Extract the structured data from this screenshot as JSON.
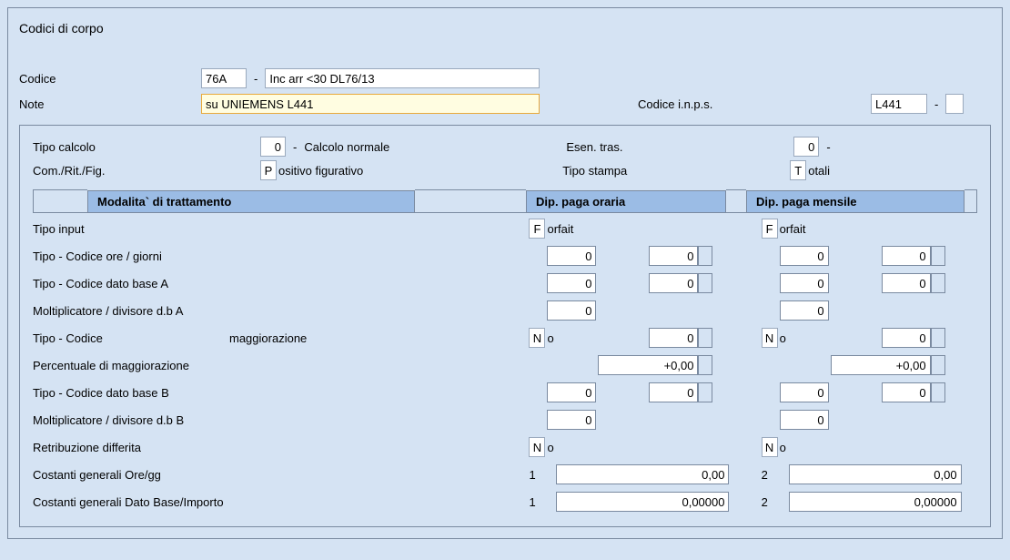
{
  "panel_title": "Codici di corpo",
  "codice": {
    "label": "Codice",
    "code": "76A",
    "desc": "Inc arr <30 DL76/13"
  },
  "note": {
    "label": "Note",
    "value": "su UNIEMENS L441"
  },
  "code_inps": {
    "label": "Codice i.n.p.s.",
    "value": "L441"
  },
  "tipo_calcolo": {
    "label": "Tipo calcolo",
    "code": "0",
    "desc": "Calcolo normale"
  },
  "esen_tras": {
    "label": "Esen. tras.",
    "code": "0"
  },
  "com_rit_fig": {
    "label": "Com./Rit./Fig.",
    "prefix": "P",
    "desc": "ositivo figurativo"
  },
  "tipo_stampa": {
    "label": "Tipo stampa",
    "prefix": "T",
    "desc": "otali"
  },
  "tabs": {
    "modo": "Modalita` di trattamento",
    "oraria": "Dip. paga oraria",
    "mensile": "Dip. paga mensile"
  },
  "rows": {
    "tipo_input": {
      "label": "Tipo input"
    },
    "tipo_cod_ore": {
      "label": "Tipo - Codice ore / giorni"
    },
    "tipo_cod_base_a": {
      "label": "Tipo - Codice dato base A"
    },
    "molt_div_a": {
      "label": "Moltiplicatore / divisore d.b A"
    },
    "tipo_cod_magg": {
      "label1": "Tipo - Codice",
      "label2": "maggiorazione"
    },
    "perc_magg": {
      "label": "Percentuale di maggiorazione"
    },
    "tipo_cod_base_b": {
      "label": "Tipo - Codice dato base B"
    },
    "molt_div_b": {
      "label": "Moltiplicatore / divisore d.b B"
    },
    "retr_diff": {
      "label": "Retribuzione differita"
    },
    "cost_ore": {
      "label": "Costanti generali Ore/gg"
    },
    "cost_dato": {
      "label": "Costanti generali Dato Base/Importo"
    }
  },
  "oraria": {
    "tipo_input_prefix": "F",
    "tipo_input_desc": "orfait",
    "ore_1": "0",
    "ore_2": "0",
    "baseA_1": "0",
    "baseA_2": "0",
    "molt_a": "0",
    "magg_prefix": "N",
    "magg_desc": "o",
    "magg_val": "0",
    "perc": "+0,00",
    "baseB_1": "0",
    "baseB_2": "0",
    "molt_b": "0",
    "retr_prefix": "N",
    "retr_desc": "o",
    "cost_ore_code": "1",
    "cost_ore_val": "0,00",
    "cost_dato_code": "1",
    "cost_dato_val": "0,00000"
  },
  "mensile": {
    "tipo_input_prefix": "F",
    "tipo_input_desc": "orfait",
    "ore_1": "0",
    "ore_2": "0",
    "baseA_1": "0",
    "baseA_2": "0",
    "molt_a": "0",
    "magg_prefix": "N",
    "magg_desc": "o",
    "magg_val": "0",
    "perc": "+0,00",
    "baseB_1": "0",
    "baseB_2": "0",
    "molt_b": "0",
    "retr_prefix": "N",
    "retr_desc": "o",
    "cost_ore_code": "2",
    "cost_ore_val": "0,00",
    "cost_dato_code": "2",
    "cost_dato_val": "0,00000"
  }
}
